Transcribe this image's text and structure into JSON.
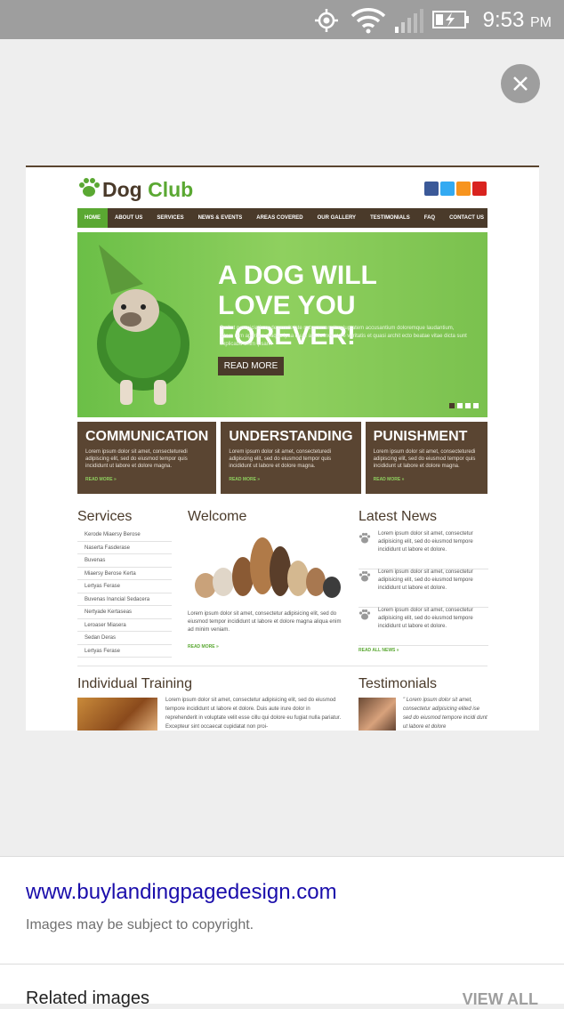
{
  "status_bar": {
    "time": "9:53",
    "ampm": "PM",
    "icons": [
      "gps-icon",
      "wifi-icon",
      "signal-icon",
      "battery-charging-icon"
    ]
  },
  "viewer": {
    "close_icon": "close-icon"
  },
  "preview": {
    "logo": {
      "dog": "Dog",
      "club": "Club"
    },
    "nav": [
      "HOME",
      "ABOUT US",
      "SERVICES",
      "NEWS & EVENTS",
      "AREAS COVERED",
      "OUR GALLERY",
      "TESTIMONIALS",
      "FAQ",
      "CONTACT US"
    ],
    "hero": {
      "title_line1": "A DOG WILL",
      "title_line2": "LOVE  YOU FOREVER!",
      "text": "Sed ut perspiciatis unde omnis iste natus error sit voluptatem accusantium doloremque laudantium, totam rem aperiam, eaque ipsa quae ab illo inventore veritatis et quasi archit ecto beatae vitae dicta sunt explicabo enim ipsam.",
      "button": "READ MORE"
    },
    "boxes": [
      {
        "title": "COMMUNICATION",
        "text": "Lorem ipsum dolor sit amet, consecteturedi adipiscing elit, sed do eiusmod tempor quis incididunt ut labore et dolore magna.",
        "more": "READ MORE »"
      },
      {
        "title": "UNDERSTANDING",
        "text": "Lorem ipsum dolor sit amet, consecteturedi adipiscing elit, sed do eiusmod tempor quis incididunt ut labore et dolore magna.",
        "more": "READ MORE »"
      },
      {
        "title": "PUNISHMENT",
        "text": "Lorem ipsum dolor sit amet, consecteturedi adipiscing elit, sed do eiusmod tempor quis incididunt ut labore et dolore magna.",
        "more": "READ MORE »"
      }
    ],
    "services": {
      "title": "Services",
      "items": [
        "Kerode Miaersy Berose",
        "Naserta Fasderase",
        "Buvenas",
        "Miaersy Berose Kerta",
        "Lertyas Ferase",
        "Buvenas Inancial Sedacera",
        "Nertyade Kertaseas",
        "Leroaser Miasera",
        "Sedan Deras",
        "Lertyas Ferase"
      ]
    },
    "welcome": {
      "title": "Welcome",
      "text": "Lorem ipsum dolor sit amet, consectetur adipisicing elit, sed do eiusmod tempor incididunt ut labore et dolore magna aliqua enim ad minim veniam.",
      "more": "READ MORE »"
    },
    "news": {
      "title": "Latest News",
      "items": [
        "Lorem ipsum dolor sit amet, consectetur adipisicing elit, sed do eiusmod tempore incididunt ut labore et dolore.",
        "Lorem ipsum dolor sit amet, consectetur adipisicing elit, sed do eiusmod tempore incididunt ut labore et dolore.",
        "Lorem ipsum dolor sit amet, consectetur adipisicing elit, sed do eiusmod tempore incididunt ut labore et dolore."
      ],
      "more": "READ ALL NEWS »"
    },
    "training": {
      "title": "Individual Training",
      "text": "Lorem ipsum dolor sit amet, consectetur adipisicing elit, sed do eiusmod tempore incididunt ut labore et dolore. Duis aute irure dolor in reprehenderit in voluptate velit esse cillu qui dolore eu fugiat nulla pariatur. Excepteur sint occaecat cupidatat non proi-"
    },
    "testimonials": {
      "title": "Testimonials",
      "text": "\" Lorem ipsum dolor sit amet, consectetur adipisicing elited ise sed do eiusmod tempore incidi dunt ut labore et dolore"
    }
  },
  "sheet": {
    "url": "www.buylandingpagedesign.com",
    "copyright": "Images may be subject to copyright.",
    "related_title": "Related images",
    "view_all": "VIEW ALL"
  }
}
